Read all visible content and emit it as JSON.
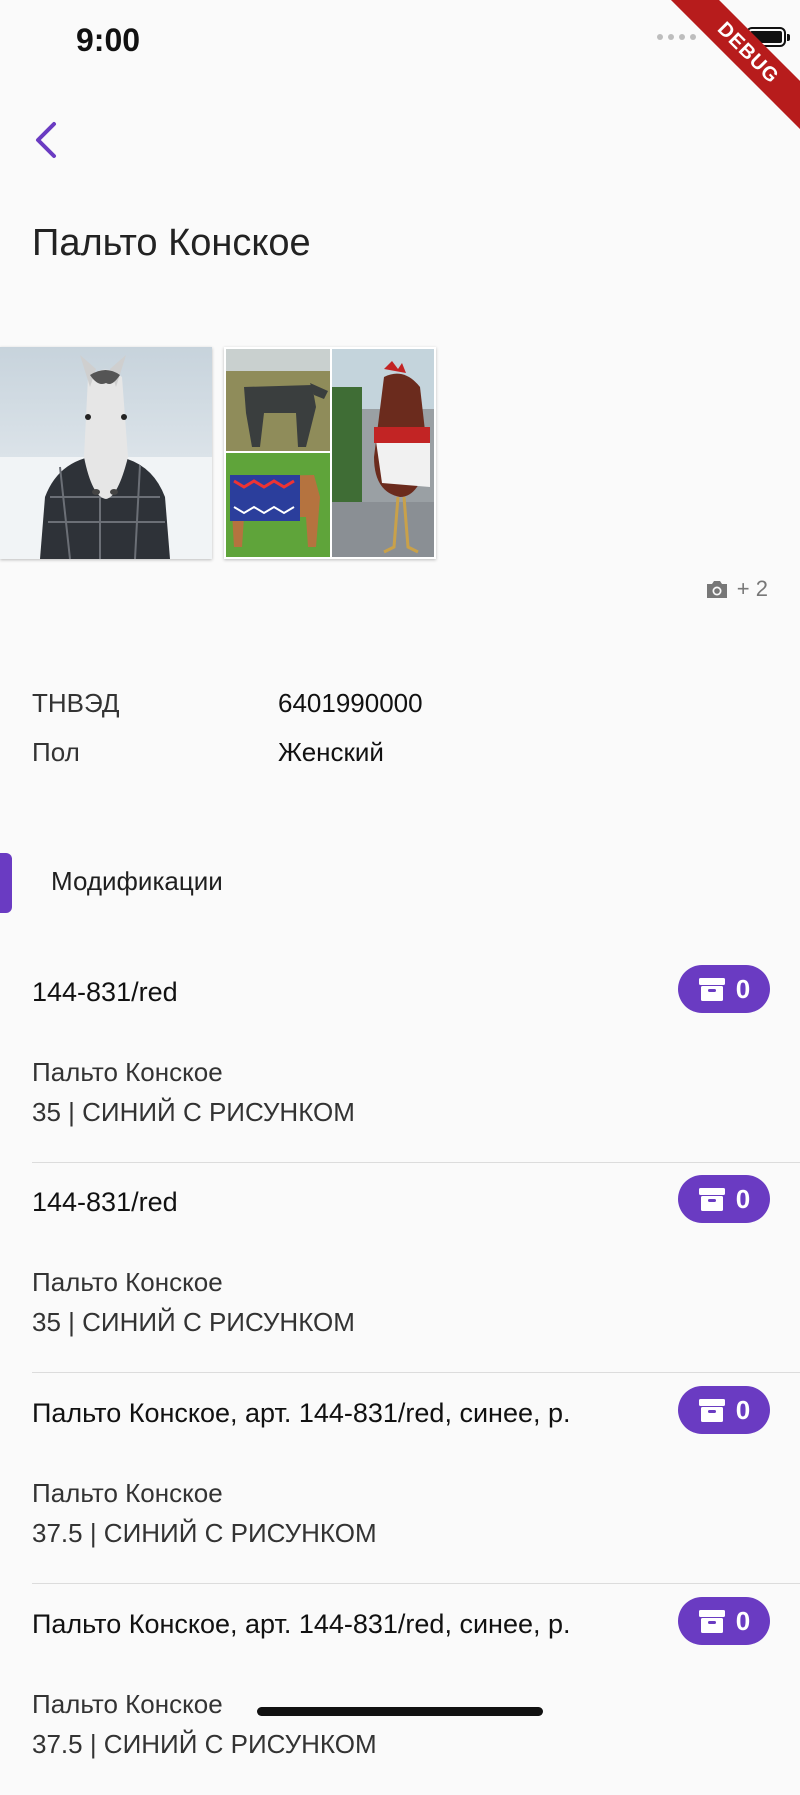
{
  "status_bar": {
    "time": "9:00"
  },
  "debug_banner": "DEBUG",
  "header": {
    "title": "Пальто Конское"
  },
  "gallery": {
    "extra_photos": "+ 2"
  },
  "attributes": [
    {
      "label": "ТНВЭД",
      "value": "6401990000"
    },
    {
      "label": "Пол",
      "value": "Женский"
    }
  ],
  "modifications": {
    "section_title": "Модификации",
    "items": [
      {
        "title": "144-831/red",
        "count": "0",
        "name": "Пальто Конское",
        "spec": "35 | СИНИЙ С РИСУНКОМ"
      },
      {
        "title": "144-831/red",
        "count": "0",
        "name": "Пальто Конское",
        "spec": "35 | СИНИЙ С РИСУНКОМ"
      },
      {
        "title": "Пальто Конское, арт. 144-831/red, синее, р.",
        "count": "0",
        "name": "Пальто Конское",
        "spec": "37.5 | СИНИЙ С РИСУНКОМ"
      },
      {
        "title": "Пальто Конское, арт. 144-831/red, синее, р.",
        "count": "0",
        "name": "Пальто Конское",
        "spec": "37.5 | СИНИЙ С РИСУНКОМ"
      }
    ]
  },
  "colors": {
    "accent": "#6a3bc2",
    "debug": "#b71c1c"
  }
}
